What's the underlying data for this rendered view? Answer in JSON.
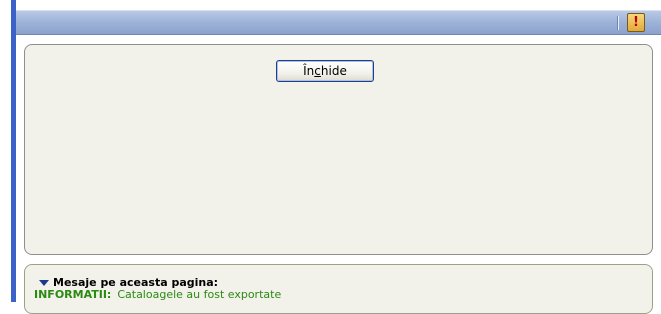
{
  "titlebar": {
    "alert_glyph": "!"
  },
  "main": {
    "close_button_label": {
      "before": "În",
      "mnemonic": "c",
      "after": "hide"
    }
  },
  "messages": {
    "header": "Mesaje pe aceasta pagina:",
    "items": [
      {
        "type_label": "INFORMATII:",
        "text": "Cataloagele au fost exportate"
      }
    ]
  },
  "colors": {
    "accent_stripe": "#3a62c8",
    "info_text": "#2a8a12",
    "alert_icon": "#c00000"
  }
}
